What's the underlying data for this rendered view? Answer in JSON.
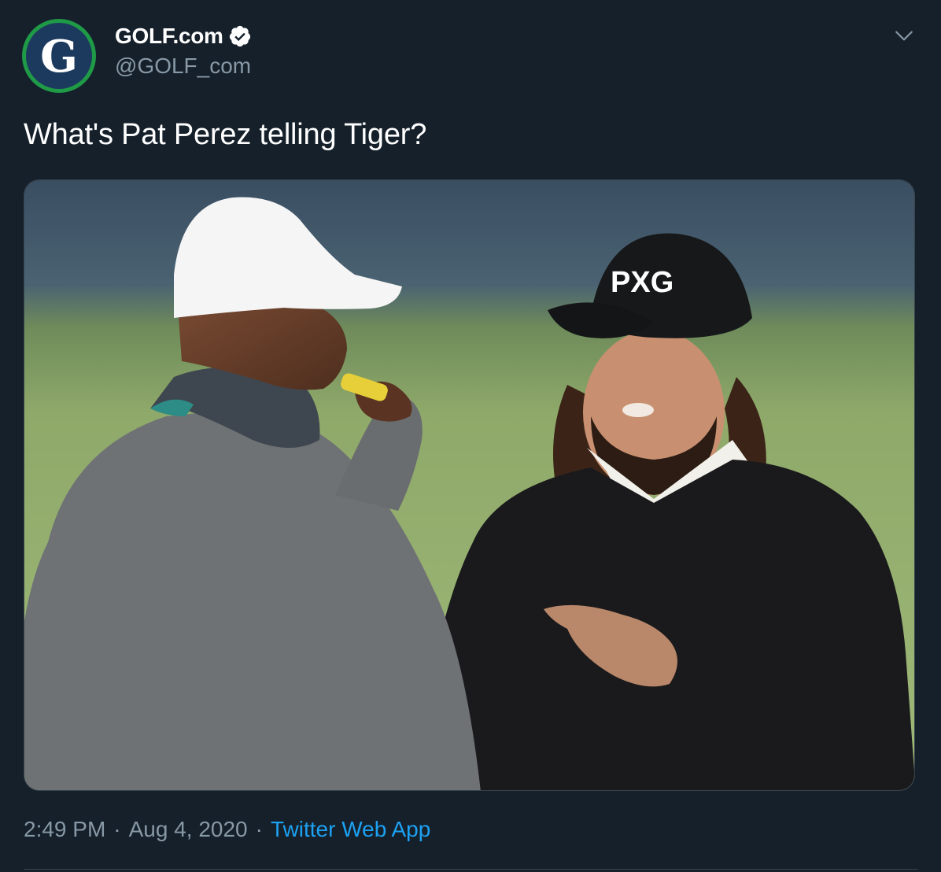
{
  "author": {
    "display_name": "GOLF.com",
    "handle": "@GOLF_com",
    "avatar_letter": "G",
    "verified": true
  },
  "tweet": {
    "text": "What's Pat Perez telling Tiger?",
    "media": {
      "type": "photo",
      "hat_logo_text": "PXG"
    }
  },
  "meta": {
    "time": "2:49 PM",
    "separator": "·",
    "date": "Aug 4, 2020",
    "source": "Twitter Web App"
  },
  "colors": {
    "background": "#15202b",
    "text": "#ffffff",
    "secondary_text": "#8899a6",
    "link": "#1da1f2",
    "avatar_ring": "#1f9a47",
    "avatar_fill": "#1c3a5e"
  }
}
